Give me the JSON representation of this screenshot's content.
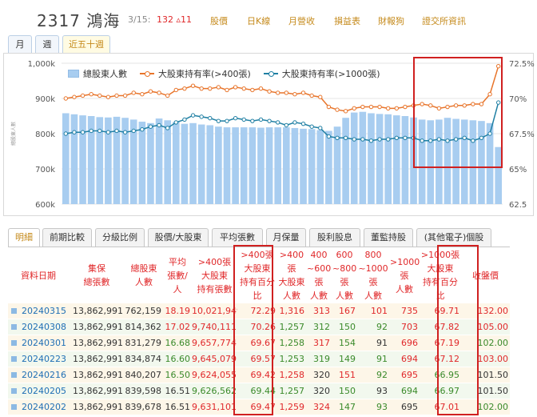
{
  "header": {
    "stock": "2317 鴻海",
    "date": "3/15:",
    "price": "132 ▵11",
    "links": [
      "股價",
      "日K線",
      "月營收",
      "損益表",
      "財報狗",
      "證交所資訊"
    ]
  },
  "period_tabs": [
    "月",
    "週",
    "近五十週"
  ],
  "chart_data": {
    "type": "bar+line",
    "legend": [
      "總股東人數",
      "大股東持有率(>400張)",
      "大股東持有率(>1000張)"
    ],
    "y_left_ticks": [
      "1,000k",
      "900k",
      "800k",
      "700k",
      "600k"
    ],
    "y_left_range": [
      600,
      1000
    ],
    "y_right_ticks": [
      "72.5%",
      "70%",
      "67.5%",
      "65%",
      "62.5"
    ],
    "y_right_range": [
      62.5,
      72.5
    ],
    "y_left_label": "總股東人數",
    "series": [
      {
        "name": "總股東人數",
        "values": [
          858,
          855,
          852,
          850,
          847,
          846,
          848,
          845,
          840,
          834,
          830,
          843,
          838,
          833,
          828,
          830,
          826,
          824,
          820,
          818,
          818,
          818,
          818,
          817,
          818,
          818,
          818,
          816,
          814,
          813,
          810,
          808,
          820,
          845,
          860,
          862,
          858,
          856,
          855,
          852,
          850,
          846,
          840,
          838,
          840,
          845,
          842,
          840,
          838,
          836,
          830,
          762
        ]
      },
      {
        "name": "大股東持有率(>400張)",
        "values": [
          70.0,
          70.1,
          70.2,
          70.3,
          70.2,
          70.1,
          70.2,
          70.2,
          70.4,
          70.3,
          70.5,
          70.4,
          70.2,
          70.6,
          70.7,
          70.9,
          70.7,
          70.7,
          70.8,
          70.6,
          70.8,
          70.7,
          70.6,
          70.7,
          70.5,
          70.4,
          70.4,
          70.3,
          70.4,
          70.2,
          70.1,
          69.4,
          69.2,
          69.1,
          69.3,
          69.4,
          69.4,
          69.4,
          69.3,
          69.3,
          69.4,
          69.5,
          69.6,
          69.5,
          69.3,
          69.4,
          69.5,
          69.5,
          69.6,
          69.6,
          70.3,
          72.29
        ]
      },
      {
        "name": "大股東持有率(>1000張)",
        "values": [
          67.5,
          67.6,
          67.6,
          67.7,
          67.7,
          67.6,
          67.7,
          67.6,
          67.7,
          67.8,
          68.0,
          68.1,
          67.9,
          68.3,
          68.5,
          68.8,
          68.7,
          68.6,
          68.4,
          68.4,
          68.6,
          68.5,
          68.4,
          68.5,
          68.4,
          68.3,
          68.1,
          68.3,
          68.2,
          68.0,
          67.9,
          67.3,
          67.2,
          67.2,
          67.1,
          67.1,
          67.0,
          67.1,
          67.1,
          67.2,
          67.2,
          67.2,
          67.0,
          67.0,
          67.1,
          67.0,
          67.1,
          67.2,
          67.0,
          67.2,
          67.5,
          69.71
        ]
      }
    ]
  },
  "table_tabs": [
    "明細",
    "前期比較",
    "分級比例",
    "股價/大股東",
    "平均張數",
    "月保量",
    "股利股息",
    "董監持股",
    "(其他電子)個股"
  ],
  "table": {
    "headers": [
      "資料日期",
      "集保\n總張數",
      "總股東\n人數",
      "平均\n張數/\n人",
      ">400張\n大股東\n持有張數",
      ">400張\n大股東\n持有百分\n比",
      ">400\n張\n大股東\n人數",
      "400\n~600\n張\n人數",
      "600\n~800\n張\n人數",
      "800\n~1000\n張\n人數",
      ">1000\n張\n人數",
      ">1000張\n大股東\n持有百分\n比",
      "收盤價"
    ],
    "rows": [
      [
        "20240315",
        "13,862,991",
        "762,159",
        "18.19",
        "10,021,949",
        "72.29",
        "1,316",
        "313",
        "167",
        "101",
        "735",
        "69.71",
        "132.00"
      ],
      [
        "20240308",
        "13,862,991",
        "814,362",
        "17.02",
        "9,740,111",
        "70.26",
        "1,257",
        "312",
        "150",
        "92",
        "703",
        "67.82",
        "105.00"
      ],
      [
        "20240301",
        "13,862,991",
        "831,279",
        "16.68",
        "9,657,774",
        "69.67",
        "1,258",
        "317",
        "154",
        "91",
        "696",
        "67.19",
        "102.00"
      ],
      [
        "20240223",
        "13,862,991",
        "834,874",
        "16.60",
        "9,645,079",
        "69.57",
        "1,253",
        "319",
        "149",
        "91",
        "694",
        "67.12",
        "103.00"
      ],
      [
        "20240216",
        "13,862,991",
        "840,207",
        "16.50",
        "9,624,055",
        "69.42",
        "1,258",
        "320",
        "151",
        "92",
        "695",
        "66.95",
        "101.50"
      ],
      [
        "20240205",
        "13,862,991",
        "839,598",
        "16.51",
        "9,626,562",
        "69.44",
        "1,257",
        "320",
        "150",
        "93",
        "694",
        "66.97",
        "101.50"
      ],
      [
        "20240202",
        "13,862,991",
        "839,678",
        "16.51",
        "9,631,101",
        "69.47",
        "1,259",
        "324",
        "147",
        "93",
        "695",
        "67.01",
        "102.00"
      ]
    ],
    "row_colors": [
      [
        "d",
        "n",
        "n",
        "r",
        "r",
        "r",
        "r",
        "r",
        "r",
        "r",
        "r",
        "r",
        "r"
      ],
      [
        "d",
        "n",
        "n",
        "r",
        "r",
        "r",
        "g",
        "g",
        "g",
        "g",
        "r",
        "r",
        "r"
      ],
      [
        "d",
        "n",
        "n",
        "g",
        "r",
        "r",
        "g",
        "r",
        "g",
        "n",
        "r",
        "r",
        "g"
      ],
      [
        "d",
        "n",
        "n",
        "g",
        "r",
        "r",
        "g",
        "g",
        "g",
        "g",
        "r",
        "r",
        "r"
      ],
      [
        "d",
        "n",
        "n",
        "g",
        "r",
        "r",
        "r",
        "n",
        "r",
        "g",
        "r",
        "g",
        "n"
      ],
      [
        "d",
        "n",
        "n",
        "n",
        "g",
        "g",
        "g",
        "n",
        "g",
        "n",
        "g",
        "g",
        "n"
      ],
      [
        "d",
        "n",
        "n",
        "n",
        "r",
        "r",
        "r",
        "r",
        "g",
        "g",
        "n",
        "r",
        "g"
      ]
    ]
  },
  "colors": {
    "bar": "#a8cdf0",
    "line400": "#e8742a",
    "line1000": "#1f7fa3",
    "highlight": "#d02020"
  }
}
